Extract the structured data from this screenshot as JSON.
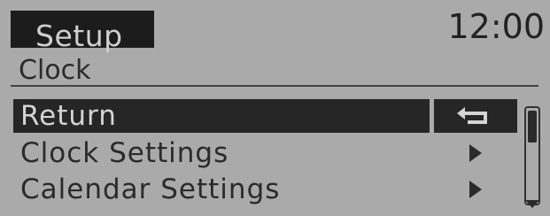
{
  "header": {
    "title": "Setup",
    "time": "12:00"
  },
  "breadcrumb": "Clock",
  "menu": {
    "items": [
      {
        "label": "Return",
        "selected": true,
        "icon": "return-icon"
      },
      {
        "label": "Clock Settings",
        "selected": false,
        "icon": "chevron-right-icon"
      },
      {
        "label": "Calendar Settings",
        "selected": false,
        "icon": "chevron-right-icon"
      }
    ]
  },
  "scroll": {
    "position": 0
  },
  "colors": {
    "background": "#aaaaaa",
    "highlight": "#262626",
    "highlight_text": "#d4d4d4",
    "text": "#222222"
  }
}
